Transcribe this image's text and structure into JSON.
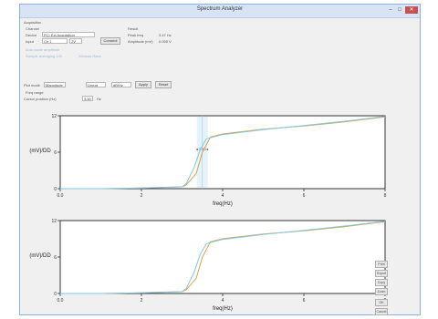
{
  "window": {
    "title": "Spectrum Analyzer",
    "minimize": "–",
    "maximize": "□",
    "close": "✕"
  },
  "panel": {
    "group_label": "Acquisition",
    "source_label": "Channel",
    "device_label": "Device",
    "device_value": "PCI Ext Acquisition",
    "input_label": "Input",
    "input_value": "Ch 1",
    "range_value": "2V",
    "connect_label": "Connect",
    "option1_label": "Auto-scale amplitude",
    "option2_label": "Sample averaging  100",
    "option3_label": "Window  Hann"
  },
  "info": {
    "heading": "Result",
    "peak_label": "Peak freq",
    "peak_value": "3.47 Hz",
    "amp_label": "Amplitude (mV)",
    "amp_value": "0.095 V"
  },
  "controls": {
    "mode_label": "Plot mode",
    "mode_value": "Magnitude",
    "linear_value": "Linear",
    "log_value": "dB/Hz",
    "apply_label": "Apply",
    "reset_label": "Reset",
    "sub_label": "Freq range",
    "cursor_label": "Cursor position (Hz)",
    "cursor_value": "3.50",
    "cursor_unit": "Hz"
  },
  "side_buttons": [
    "Print",
    "Export",
    "Copy",
    "Zoom"
  ],
  "bottom_buttons": [
    "OK",
    "Cancel"
  ],
  "chart_data": [
    {
      "type": "line",
      "ylabel": "(mV)/DD",
      "xlabel": "freq(Hz)",
      "xlim": [
        0,
        8
      ],
      "ylim": [
        0,
        12
      ],
      "xticks": [
        "0.0",
        "2",
        "4",
        "6",
        "8"
      ],
      "yticks": [
        "0",
        "6",
        "12"
      ],
      "marker": {
        "x": 3.5,
        "label": "3.50"
      },
      "series": [
        {
          "color": "#e0a040",
          "x": [
            0,
            1,
            2,
            3,
            3.1,
            3.35,
            3.5,
            3.7,
            4,
            5,
            6,
            7,
            8
          ],
          "y": [
            0,
            0,
            0.1,
            0.3,
            0.6,
            2.5,
            6,
            8.5,
            9,
            9.8,
            10.3,
            11,
            11.8
          ]
        },
        {
          "color": "#7fc8e8",
          "x": [
            0,
            1,
            2,
            3,
            3.1,
            3.3,
            3.45,
            3.6,
            4,
            5,
            6,
            7,
            8
          ],
          "y": [
            0,
            0,
            0.1,
            0.3,
            0.8,
            3.5,
            6.5,
            8.2,
            8.9,
            9.7,
            10.4,
            11.1,
            11.9
          ]
        }
      ]
    },
    {
      "type": "line",
      "ylabel": "(mV)/DD",
      "xlabel": "freq(Hz)",
      "xlim": [
        0,
        8
      ],
      "ylim": [
        0,
        12
      ],
      "xticks": [
        "0.0",
        "2",
        "4",
        "6",
        "8"
      ],
      "yticks": [
        "0",
        "6",
        "12"
      ],
      "series": [
        {
          "color": "#e0a040",
          "x": [
            0,
            1,
            2,
            3,
            3.1,
            3.35,
            3.5,
            3.7,
            4,
            5,
            6,
            7,
            8
          ],
          "y": [
            0,
            0,
            0.1,
            0.3,
            0.6,
            2.5,
            6,
            8.5,
            9,
            9.8,
            10.3,
            11,
            11.8
          ]
        },
        {
          "color": "#7fc8e8",
          "x": [
            0,
            1,
            2,
            3,
            3.1,
            3.3,
            3.45,
            3.6,
            4,
            5,
            6,
            7,
            8
          ],
          "y": [
            0,
            0,
            0.1,
            0.3,
            0.8,
            3.5,
            6.5,
            8.2,
            8.9,
            9.7,
            10.4,
            11.1,
            11.9
          ]
        }
      ]
    }
  ]
}
